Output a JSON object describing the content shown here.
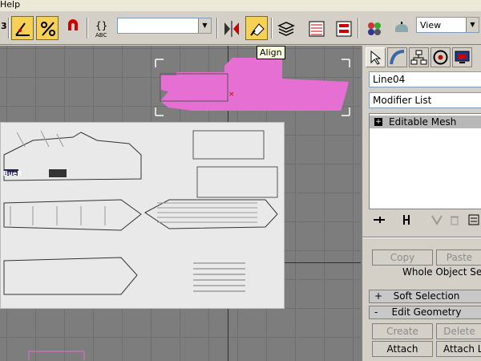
{
  "menu": {
    "help_label": "Help"
  },
  "toolbar": {
    "left_fragment": "3",
    "named_selection_value": "",
    "view_dropdown_value": "View",
    "buttons": [
      {
        "name": "angle-snap-icon",
        "active": true
      },
      {
        "name": "percent-snap-icon",
        "active": true
      },
      {
        "name": "spinner-snap-icon",
        "active": false
      },
      {
        "name": "edit-named-selection-icon",
        "active": false
      },
      {
        "name": "mirror-icon",
        "active": false
      },
      {
        "name": "align-icon",
        "active": true
      },
      {
        "name": "layer-manager-icon",
        "active": false
      },
      {
        "name": "curve-editor-icon",
        "active": false
      },
      {
        "name": "schematic-view-icon",
        "active": false
      },
      {
        "name": "material-editor-icon",
        "active": false
      },
      {
        "name": "render-scene-icon",
        "active": false
      }
    ]
  },
  "tooltip": {
    "text": "Align"
  },
  "viewport": {
    "blueprint_label": "Buell",
    "grid_color": "#6f6f6f",
    "background": "#7d7d7d",
    "object_color": "#e56fd3"
  },
  "command_panel": {
    "tabs": [
      "create-tab",
      "modify-tab",
      "hierarchy-tab",
      "motion-tab",
      "display-tab"
    ],
    "object_name": "Line04",
    "modifier_list_label": "Modifier List",
    "stack_items": [
      {
        "label": "Editable Mesh",
        "expand": "+"
      }
    ],
    "selection": {
      "copy_label": "Copy",
      "paste_label": "Paste",
      "whole_object_label": "Whole Object Select"
    },
    "rollouts": [
      {
        "sign": "+",
        "title": "Soft Selection"
      },
      {
        "sign": "-",
        "title": "Edit Geometry"
      }
    ],
    "edit_geometry": {
      "create_label": "Create",
      "delete_label": "Delete",
      "attach_label": "Attach",
      "attach_list_label": "Attach List"
    }
  }
}
